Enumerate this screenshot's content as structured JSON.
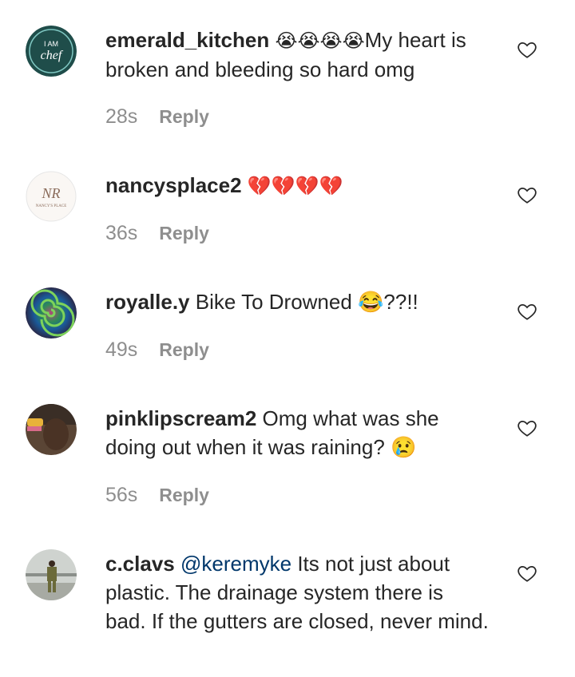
{
  "comments": [
    {
      "username": "emerald_kitchen",
      "emoji": "😭😭😭😭",
      "text": "My heart is broken and bleeding so hard omg",
      "time": "28s",
      "reply": "Reply",
      "avatar_text_1": "I AM",
      "avatar_text_2": "chef"
    },
    {
      "username": "nancysplace2",
      "emoji": "💔💔💔💔",
      "text": "",
      "time": "36s",
      "reply": "Reply",
      "avatar_text_1": "NR",
      "avatar_text_2": "NANCY'S PLACE"
    },
    {
      "username": "royalle.y",
      "emoji": "",
      "text": "Bike To Drowned 😂??!!",
      "time": "49s",
      "reply": "Reply"
    },
    {
      "username": "pinklipscream2",
      "emoji": "",
      "text": "Omg what was she doing out when it was raining? 😢",
      "time": "56s",
      "reply": "Reply"
    },
    {
      "username": "c.clavs",
      "mention": "@keremyke",
      "emoji": "",
      "text": "Its not just about plastic. The drainage system there is bad. If the gutters are closed, never mind.",
      "time": "",
      "reply": ""
    }
  ],
  "colors": {
    "text": "#262626",
    "muted": "#8e8e8e",
    "mention": "#00376b"
  },
  "icons": {
    "like": "heart-outline-icon"
  }
}
